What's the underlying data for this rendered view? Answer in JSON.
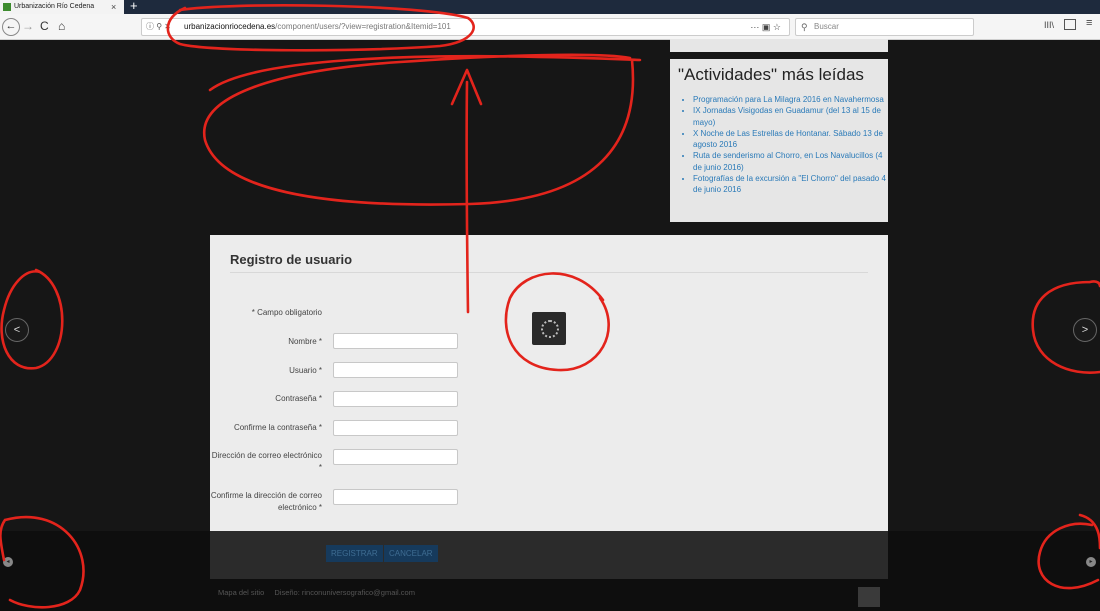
{
  "browser": {
    "tab_title": "Urbanización Río Cedena",
    "tab_close": "×",
    "new_tab": "+",
    "url_host": "urbanizacionriocedena.es",
    "url_path": "/component/users/?view=registration&Itemid=101",
    "url_security_icons": "ⓘ ⚲ ✕",
    "url_actions": "··· ▣ ☆",
    "search_placeholder": "Buscar",
    "nav": {
      "back": "←",
      "forward": "→",
      "reload": "C",
      "home": "⌂"
    },
    "menu_icons": {
      "library": "III\\",
      "menu": "≡"
    }
  },
  "popular": {
    "title": "\"Actividades\" más leídas",
    "items": [
      "Programación para La Milagra 2016 en Navahermosa",
      "IX Jornadas Visigodas en Guadamur (del 13 al 15 de mayo)",
      "X Noche de Las Estrellas de Hontanar. Sábado 13 de agosto 2016",
      "Ruta de senderismo al Chorro, en Los Navalucillos (4 de junio 2016)",
      "Fotografías de la excursión a \"El Chorro\" del pasado 4 de junio 2016"
    ]
  },
  "registration": {
    "title": "Registro de usuario",
    "required_note": "* Campo obligatorio",
    "fields": [
      {
        "label": "Nombre *",
        "value": ""
      },
      {
        "label": "Usuario *",
        "value": ""
      },
      {
        "label": "Contraseña *",
        "value": ""
      },
      {
        "label": "Confirme la contraseña *",
        "value": ""
      },
      {
        "label": "Dirección de correo electrónico *",
        "value": ""
      },
      {
        "label": "Confirme la dirección de correo electrónico *",
        "value": ""
      }
    ],
    "register_button": "REGISTRAR",
    "cancel_button": "CANCELAR"
  },
  "footer": {
    "sitemap": "Mapa del sitio",
    "design": "Diseño: rinconuniversografico@gmail.com"
  },
  "slider": {
    "prev": "<",
    "next": ">"
  },
  "colors": {
    "page_background": "#161616",
    "panel_background": "#ececec",
    "link": "#2a7ab8",
    "annotation_red": "#e3241c",
    "button": "#163a5c"
  }
}
